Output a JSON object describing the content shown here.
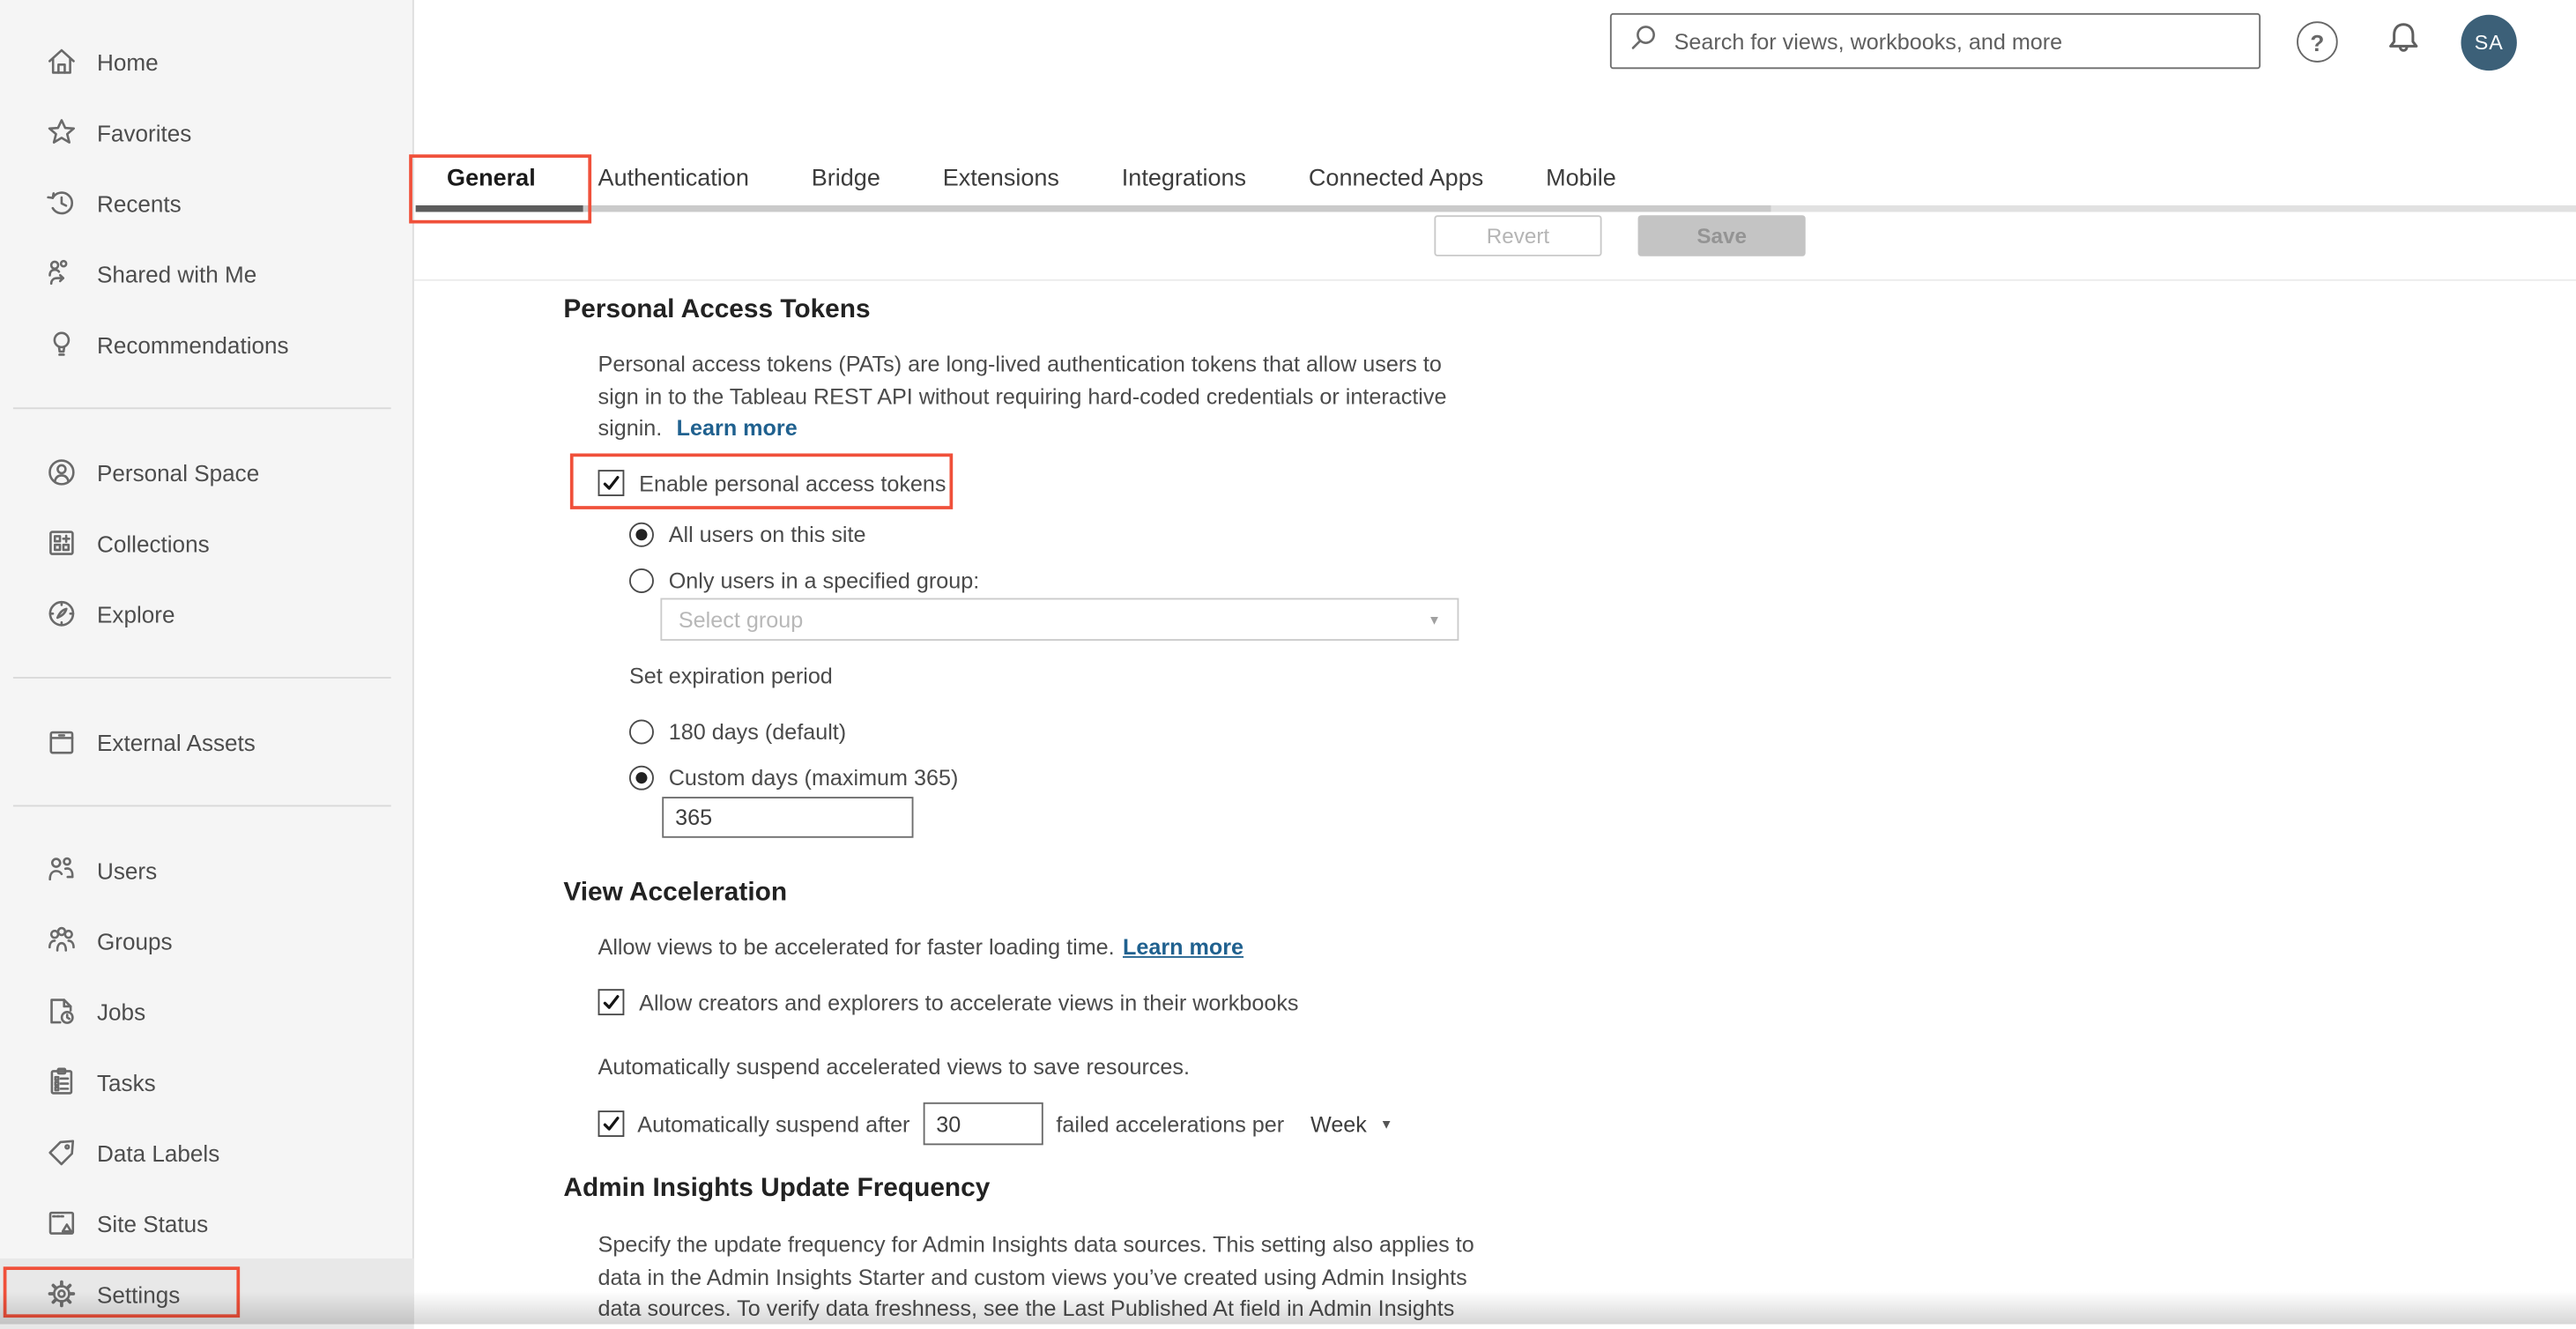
{
  "header": {
    "search_placeholder": "Search for views, workbooks, and more",
    "avatar_initials": "SA"
  },
  "sidebar": {
    "items": [
      {
        "label": "Home"
      },
      {
        "label": "Favorites"
      },
      {
        "label": "Recents"
      },
      {
        "label": "Shared with Me"
      },
      {
        "label": "Recommendations"
      },
      {
        "label": "Personal Space"
      },
      {
        "label": "Collections"
      },
      {
        "label": "Explore"
      },
      {
        "label": "External Assets"
      },
      {
        "label": "Users"
      },
      {
        "label": "Groups"
      },
      {
        "label": "Jobs"
      },
      {
        "label": "Tasks"
      },
      {
        "label": "Data Labels"
      },
      {
        "label": "Site Status"
      },
      {
        "label": "Settings",
        "selected": true
      }
    ]
  },
  "tabs": {
    "items": [
      {
        "label": "General",
        "active": true
      },
      {
        "label": "Authentication"
      },
      {
        "label": "Bridge"
      },
      {
        "label": "Extensions"
      },
      {
        "label": "Integrations"
      },
      {
        "label": "Connected Apps"
      },
      {
        "label": "Mobile"
      }
    ]
  },
  "actions": {
    "revert_label": "Revert",
    "save_label": "Save"
  },
  "pat": {
    "title": "Personal Access Tokens",
    "description_lines": [
      "Personal access tokens (PATs) are long-lived authentication tokens that allow users to",
      "sign in to the Tableau REST API without requiring hard-coded credentials or interactive",
      "signin."
    ],
    "learn_more_label": "Learn more",
    "enable_checkbox_label": "Enable personal access tokens",
    "enable_checked": true,
    "scope_options": [
      {
        "label": "All users on this site",
        "selected": true
      },
      {
        "label": "Only users in a specified group:",
        "selected": false
      }
    ],
    "group_select_placeholder": "Select group",
    "expiration_label": "Set expiration period",
    "expiration_options": [
      {
        "label": "180 days (default)",
        "selected": false
      },
      {
        "label": "Custom days (maximum 365)",
        "selected": true
      }
    ],
    "custom_days_value": "365"
  },
  "view_acceleration": {
    "title": "View Acceleration",
    "description": "Allow views to be accelerated for faster loading time.",
    "learn_more_label": "Learn more",
    "allow_checkbox_label": "Allow creators and explorers to accelerate views in their workbooks",
    "allow_checked": true,
    "suspend_note": "Automatically suspend accelerated views to save resources.",
    "suspend_checkbox_label": "Automatically suspend after",
    "suspend_checked": true,
    "suspend_threshold_value": "30",
    "suspend_suffix_label": "failed accelerations per",
    "suspend_period_value": "Week"
  },
  "admin_insights": {
    "title": "Admin Insights Update Frequency",
    "description_lines": [
      "Specify the update frequency for Admin Insights data sources. This setting also applies to",
      "data in the Admin Insights Starter and custom views you’ve created using Admin Insights",
      "data sources. To verify data freshness, see the Last Published At field in Admin Insights"
    ]
  },
  "colors": {
    "annotation_red": "#f0503a",
    "avatar_bg": "#3c6078",
    "link_blue": "#20618f",
    "active_tab_underline": "#5c5c5c",
    "sidebar_bg": "#f5f5f5"
  }
}
